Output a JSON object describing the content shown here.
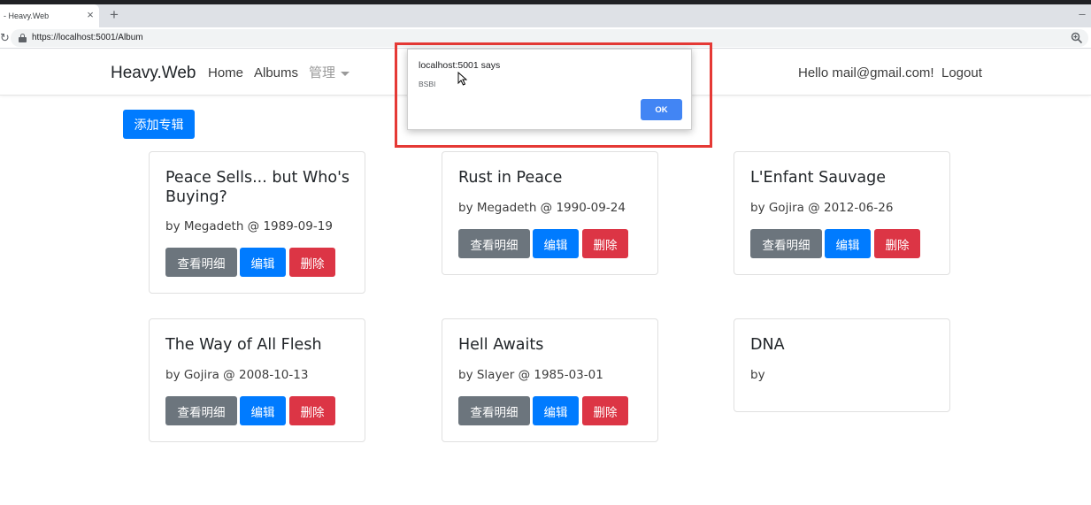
{
  "browser": {
    "tab_title": "- Heavy.Web",
    "tab_close": "×",
    "new_tab": "+",
    "window_minimize": "–",
    "url": "https://localhost:5001/Album",
    "icons": [
      "reload-icon",
      "lock-icon",
      "zoom-icon"
    ]
  },
  "navbar": {
    "brand": "Heavy.Web",
    "links": [
      "Home",
      "Albums",
      "管理"
    ],
    "greeting": "Hello mail@gmail.com!",
    "logout": "Logout"
  },
  "page": {
    "add_album_button": "添加专辑",
    "albums": [
      {
        "title": "Peace Sells... but Who's Buying?",
        "subtitle": "by Megadeth @ 1989-09-19",
        "has_actions": true
      },
      {
        "title": "Rust in Peace",
        "subtitle": "by Megadeth @ 1990-09-24",
        "has_actions": true
      },
      {
        "title": "L'Enfant Sauvage",
        "subtitle": "by Gojira @ 2012-06-26",
        "has_actions": true
      },
      {
        "title": "The Way of All Flesh",
        "subtitle": "by Gojira @ 2008-10-13",
        "has_actions": true
      },
      {
        "title": "Hell Awaits",
        "subtitle": "by Slayer @ 1985-03-01",
        "has_actions": true
      },
      {
        "title": "DNA",
        "subtitle": "by",
        "has_actions": false
      }
    ],
    "actions": {
      "view": "查看明细",
      "edit": "编辑",
      "delete": "删除"
    }
  },
  "dialog": {
    "title": "localhost:5001 says",
    "message": "BSBI",
    "ok_label": "OK"
  },
  "colors": {
    "primary": "#007bff",
    "secondary": "#6c757d",
    "danger": "#dc3545",
    "dialog_ok": "#4285f4",
    "highlight": "#e53935"
  }
}
